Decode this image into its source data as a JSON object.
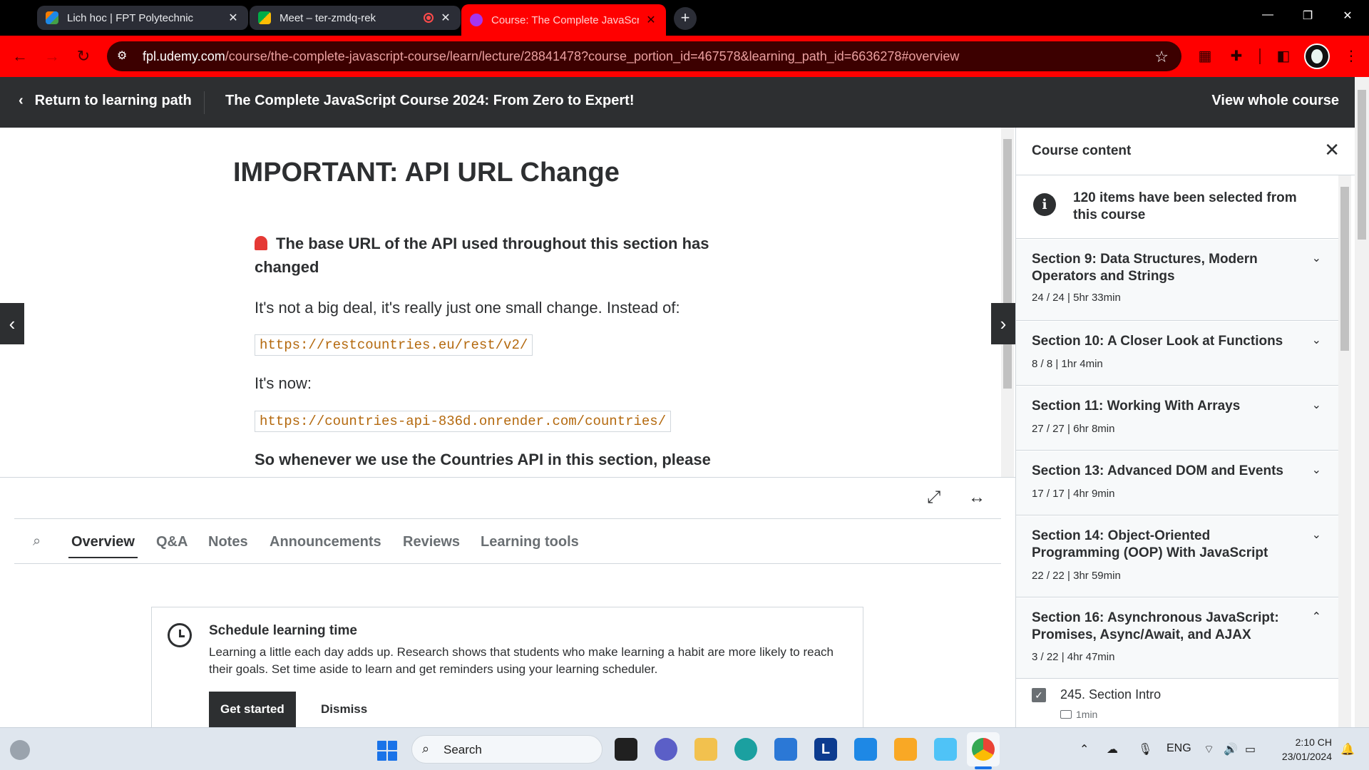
{
  "browser": {
    "tabs": [
      {
        "title": "Lich hoc | FPT Polytechnic",
        "active": false
      },
      {
        "title": "Meet – ter-zmdq-rek",
        "active": false
      },
      {
        "title": "Course: The Complete JavaScrip",
        "active": true
      }
    ],
    "new_tab": "+",
    "url_host": "fpl.udemy.com",
    "url_path": "/course/the-complete-javascript-course/learn/lecture/28841478?course_portion_id=467578&learning_path_id=6636278#overview"
  },
  "header": {
    "back_label": "Return to learning path",
    "course_title": "The Complete JavaScript Course 2024: From Zero to Expert!",
    "view_whole_label": "View whole course"
  },
  "lecture": {
    "title": "IMPORTANT: API URL Change",
    "heading": "The base URL of the API used throughout this section has changed",
    "p1": "It's not a big deal, it's really just one small change. Instead of:",
    "old_url": "https://restcountries.eu/rest/v2/",
    "p2": "It's now:",
    "new_url": "https://countries-api-836d.onrender.com/countries/",
    "p3": "So whenever we use the Countries API in this section, please"
  },
  "tabs": {
    "items": [
      "Overview",
      "Q&A",
      "Notes",
      "Announcements",
      "Reviews",
      "Learning tools"
    ],
    "active": "Overview"
  },
  "schedule": {
    "title": "Schedule learning time",
    "body": "Learning a little each day adds up. Research shows that students who make learning a habit are more likely to reach their goals. Set time aside to learn and get reminders using your learning scheduler.",
    "get_started": "Get started",
    "dismiss": "Dismiss"
  },
  "sidebar": {
    "title": "Course content",
    "info": "120 items have been selected from this course",
    "sections": [
      {
        "title": "Section 9: Data Structures, Modern Operators and Strings",
        "meta": "24 / 24 | 5hr 33min",
        "expanded": false
      },
      {
        "title": "Section 10: A Closer Look at Functions",
        "meta": "8 / 8 | 1hr 4min",
        "expanded": false
      },
      {
        "title": "Section 11: Working With Arrays",
        "meta": "27 / 27 | 6hr 8min",
        "expanded": false
      },
      {
        "title": "Section 13: Advanced DOM and Events",
        "meta": "17 / 17 | 4hr 9min",
        "expanded": false
      },
      {
        "title": "Section 14: Object-Oriented Programming (OOP) With JavaScript",
        "meta": "22 / 22 | 3hr 59min",
        "expanded": false
      },
      {
        "title": "Section 16: Asynchronous JavaScript: Promises, Async/Await, and AJAX",
        "meta": "3 / 22 | 4hr 47min",
        "expanded": true
      }
    ],
    "lesson": {
      "label": "245. Section Intro",
      "duration": "1min",
      "completed": true
    }
  },
  "taskbar": {
    "search_label": "Search",
    "lang": "ENG",
    "time": "2:10 CH",
    "date": "23/01/2024"
  },
  "colors": {
    "browser_accent": "#ff0000",
    "udemy_dark": "#2d2f31",
    "code_text": "#b4690e"
  }
}
